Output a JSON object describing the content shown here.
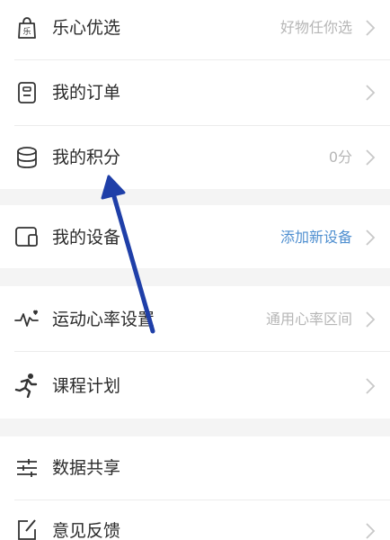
{
  "menu": {
    "lexin_select": {
      "label": "乐心优选",
      "value": "好物任你选",
      "icon": "shopping-bag-icon"
    },
    "my_orders": {
      "label": "我的订单",
      "icon": "order-clipboard-icon"
    },
    "my_points": {
      "label": "我的积分",
      "value": "0分",
      "icon": "coin-stack-icon"
    },
    "my_devices": {
      "label": "我的设备",
      "value": "添加新设备",
      "icon": "device-icon"
    },
    "heart_rate": {
      "label": "运动心率设置",
      "value": "通用心率区间",
      "icon": "heart-rate-icon"
    },
    "course_plan": {
      "label": "课程计划",
      "icon": "running-person-icon"
    },
    "data_share": {
      "label": "数据共享",
      "icon": "sliders-icon"
    },
    "feedback": {
      "label": "意见反馈",
      "icon": "edit-icon"
    }
  },
  "colors": {
    "text": "#2b2b2b",
    "muted": "#b6b6b6",
    "accent": "#4f8fd0",
    "annotation_arrow": "#1f3fa8"
  }
}
